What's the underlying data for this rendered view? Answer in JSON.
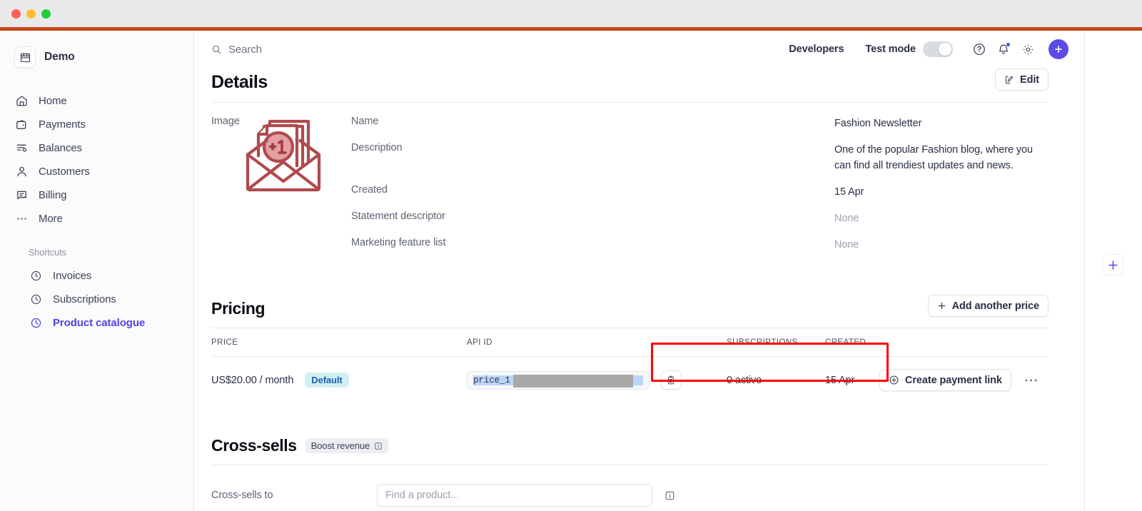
{
  "window": {
    "accent_color": "#c14814",
    "traffic_lights": [
      "close",
      "minimize",
      "zoom"
    ]
  },
  "sidebar": {
    "brand": {
      "name": "Demo",
      "icon": "store-icon"
    },
    "items": [
      {
        "label": "Home",
        "icon": "home-icon"
      },
      {
        "label": "Payments",
        "icon": "wallet-icon"
      },
      {
        "label": "Balances",
        "icon": "balances-icon"
      },
      {
        "label": "Customers",
        "icon": "person-icon"
      },
      {
        "label": "Billing",
        "icon": "billing-icon"
      },
      {
        "label": "More",
        "icon": "ellipsis-icon"
      }
    ],
    "shortcuts_label": "Shortcuts",
    "shortcuts": [
      {
        "label": "Invoices",
        "icon": "clock-icon",
        "active": false
      },
      {
        "label": "Subscriptions",
        "icon": "clock-icon",
        "active": false
      },
      {
        "label": "Product catalogue",
        "icon": "clock-icon",
        "active": true
      }
    ],
    "active_color": "#4f46e5"
  },
  "topbar": {
    "search_placeholder": "Search",
    "developers_label": "Developers",
    "test_mode_label": "Test mode",
    "test_mode_on": false,
    "help_icon": "question-circle-icon",
    "notifications_icon": "bell-icon",
    "has_notification": true,
    "settings_icon": "gear-icon",
    "create_icon": "plus-icon",
    "create_color": "#5b4ae8"
  },
  "details": {
    "title": "Details",
    "edit_label": "Edit",
    "edit_icon": "pencil-square-icon",
    "rows": [
      {
        "label": "Name",
        "value": "Fashion Newsletter",
        "muted": false
      },
      {
        "label": "Description",
        "value": "One of the popular Fashion blog, where you can find all trendiest updates and news.",
        "muted": false
      },
      {
        "label": "Created",
        "value": "15 Apr",
        "muted": false
      },
      {
        "label": "Statement descriptor",
        "value": "None",
        "muted": true
      },
      {
        "label": "Marketing feature list",
        "value": "None",
        "muted": true
      }
    ],
    "image_label": "Image",
    "image_alt": "envelope-with-plus-one-document-illustration",
    "image_color": "#b04a4e"
  },
  "pricing": {
    "title": "Pricing",
    "add_price_label": "Add another price",
    "add_price_icon": "plus-icon",
    "columns": [
      "PRICE",
      "API ID",
      "SUBSCRIPTIONS",
      "CREATED"
    ],
    "rows": [
      {
        "price": "US$20.00 / month",
        "badge": "Default",
        "api_id": "price_1",
        "api_id_redacted": true,
        "copy_icon": "clipboard-icon",
        "subscriptions": "0 active",
        "created": "15 Apr",
        "action_label": "Create payment link",
        "action_icon": "plus-circle-icon",
        "overflow_icon": "ellipsis-icon"
      }
    ],
    "highlight_color": "#ff0000"
  },
  "cross_sells": {
    "title": "Cross-sells",
    "badge": "Boost revenue",
    "badge_icon": "info-icon",
    "field_label": "Cross-sells to",
    "field_placeholder": "Find a product...",
    "field_value": "",
    "info_icon": "info-icon"
  },
  "right_rail": {
    "add_icon": "plus-icon",
    "add_color": "#5b4ae8"
  }
}
